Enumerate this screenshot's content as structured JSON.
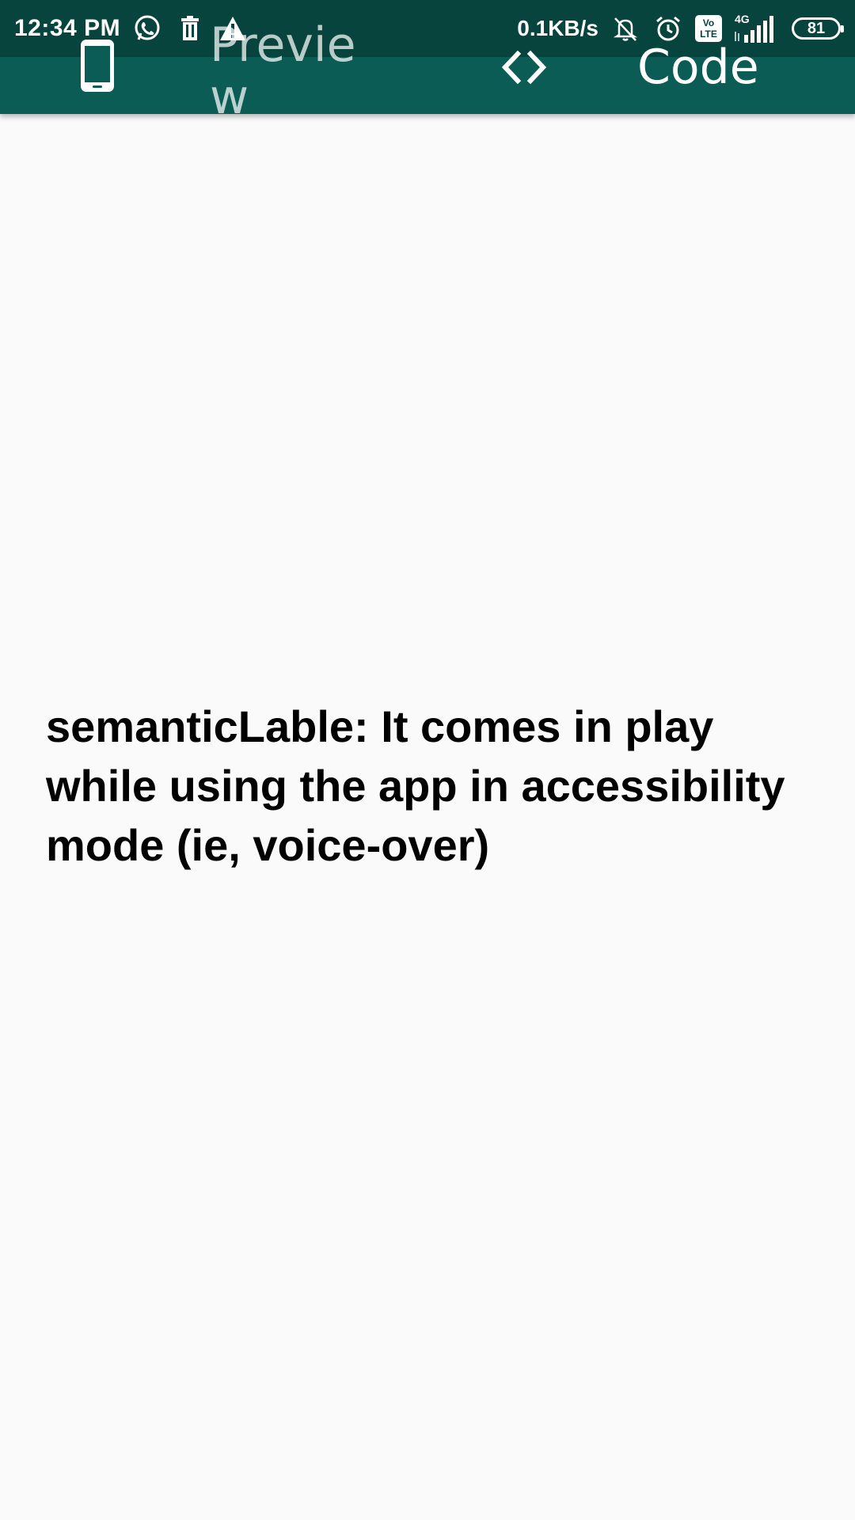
{
  "status_bar": {
    "time": "12:34 PM",
    "network_speed": "0.1KB/s",
    "network_type": "4G",
    "volte_label_top": "Vo",
    "volte_label_bottom": "LTE",
    "battery_level": "81",
    "left_icons": [
      "whatsapp-icon",
      "trash-icon",
      "warning-icon"
    ],
    "right_icons": [
      "muted-bell-icon",
      "alarm-icon",
      "volte-icon",
      "signal-icon",
      "battery-icon"
    ]
  },
  "tabs": [
    {
      "label": "Preview",
      "icon": "phone-icon"
    },
    {
      "label": "Code",
      "icon": "code-icon"
    }
  ],
  "content": {
    "description": "semanticLable: It comes in play while using the app in accessibility mode (ie, voice-over)"
  },
  "colors": {
    "status_bar_bg": "#07443d",
    "app_bar_bg": "#0a5c54",
    "page_bg": "#fafafa",
    "text": "#000000"
  }
}
